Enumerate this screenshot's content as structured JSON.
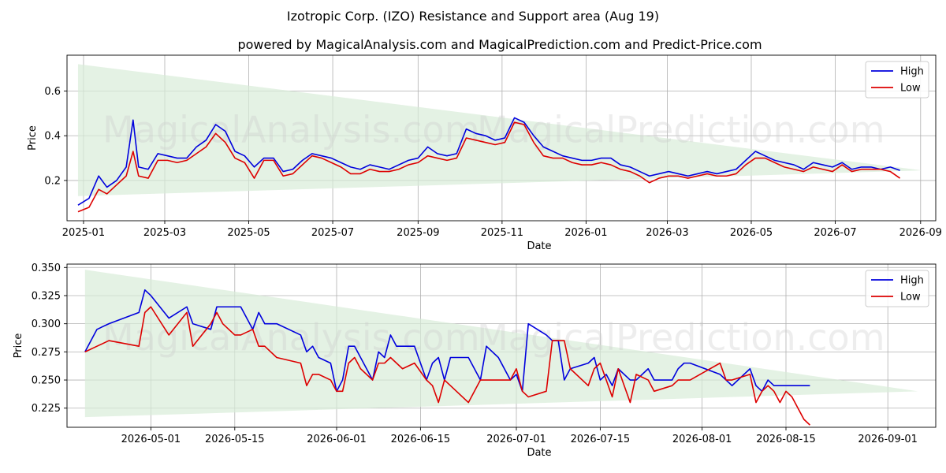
{
  "title": "Izotropic Corp. (IZO) Resistance and Support area (Aug 19)",
  "subtitle": "powered by MagicalAnalysis.com and MagicalPrediction.com and Predict-Price.com",
  "watermarks": [
    "MagicalAnalysis.com",
    "MagicalPrediction.com"
  ],
  "colors": {
    "high": "#0000dd",
    "low": "#dd0000",
    "band": "#d9ecd9"
  },
  "chart_data": [
    {
      "type": "line",
      "xlabel": "Date",
      "ylabel": "Price",
      "xlim": [
        "2024-12-20",
        "2026-09-12"
      ],
      "ylim": [
        0.02,
        0.76
      ],
      "xticks": [
        "2025-01",
        "2025-03",
        "2025-05",
        "2025-07",
        "2025-09",
        "2025-11",
        "2026-01",
        "2026-03",
        "2026-05",
        "2026-07",
        "2026-09"
      ],
      "yticks": [
        "0.2",
        "0.4",
        "0.6"
      ],
      "legend": "top-right",
      "grid": true,
      "band": {
        "start": "2024-12-28",
        "end": "2026-09-02",
        "upper_start": 0.72,
        "lower_start": 0.13,
        "upper_end": 0.245,
        "lower_end": 0.245
      },
      "series": [
        {
          "name": "High",
          "x": [
            "2024-12-28",
            "2025-01-05",
            "2025-01-12",
            "2025-01-18",
            "2025-01-25",
            "2025-02-01",
            "2025-02-06",
            "2025-02-10",
            "2025-02-17",
            "2025-02-24",
            "2025-03-03",
            "2025-03-10",
            "2025-03-17",
            "2025-03-24",
            "2025-03-31",
            "2025-04-07",
            "2025-04-14",
            "2025-04-21",
            "2025-04-28",
            "2025-05-05",
            "2025-05-12",
            "2025-05-19",
            "2025-05-26",
            "2025-06-02",
            "2025-06-09",
            "2025-06-16",
            "2025-06-23",
            "2025-06-30",
            "2025-07-07",
            "2025-07-14",
            "2025-07-21",
            "2025-07-28",
            "2025-08-04",
            "2025-08-11",
            "2025-08-18",
            "2025-08-25",
            "2025-09-01",
            "2025-09-08",
            "2025-09-15",
            "2025-09-22",
            "2025-09-29",
            "2025-10-06",
            "2025-10-13",
            "2025-10-20",
            "2025-10-27",
            "2025-11-03",
            "2025-11-10",
            "2025-11-17",
            "2025-11-24",
            "2025-12-01",
            "2025-12-08",
            "2025-12-15",
            "2025-12-22",
            "2025-12-29",
            "2026-01-05",
            "2026-01-12",
            "2026-01-19",
            "2026-01-26",
            "2026-02-02",
            "2026-02-09",
            "2026-02-16",
            "2026-02-23",
            "2026-03-02",
            "2026-03-09",
            "2026-03-16",
            "2026-03-23",
            "2026-03-30",
            "2026-04-06",
            "2026-04-13",
            "2026-04-20",
            "2026-04-27",
            "2026-05-04",
            "2026-05-11",
            "2026-05-18",
            "2026-05-25",
            "2026-06-01",
            "2026-06-08",
            "2026-06-15",
            "2026-06-22",
            "2026-06-29",
            "2026-07-06",
            "2026-07-13",
            "2026-07-20",
            "2026-07-27",
            "2026-08-03",
            "2026-08-10",
            "2026-08-17"
          ],
          "values": [
            0.09,
            0.12,
            0.22,
            0.17,
            0.2,
            0.26,
            0.47,
            0.26,
            0.25,
            0.32,
            0.31,
            0.3,
            0.3,
            0.35,
            0.38,
            0.45,
            0.42,
            0.33,
            0.31,
            0.26,
            0.3,
            0.3,
            0.24,
            0.25,
            0.29,
            0.32,
            0.31,
            0.3,
            0.28,
            0.26,
            0.25,
            0.27,
            0.26,
            0.25,
            0.27,
            0.29,
            0.3,
            0.35,
            0.32,
            0.31,
            0.32,
            0.43,
            0.41,
            0.4,
            0.38,
            0.39,
            0.48,
            0.46,
            0.4,
            0.35,
            0.33,
            0.31,
            0.3,
            0.29,
            0.29,
            0.3,
            0.3,
            0.27,
            0.26,
            0.24,
            0.22,
            0.23,
            0.24,
            0.23,
            0.22,
            0.23,
            0.24,
            0.23,
            0.24,
            0.25,
            0.29,
            0.33,
            0.31,
            0.29,
            0.28,
            0.27,
            0.25,
            0.28,
            0.27,
            0.26,
            0.28,
            0.25,
            0.26,
            0.26,
            0.25,
            0.26,
            0.245
          ]
        },
        {
          "name": "Low",
          "x": [
            "2024-12-28",
            "2025-01-05",
            "2025-01-12",
            "2025-01-18",
            "2025-01-25",
            "2025-02-01",
            "2025-02-06",
            "2025-02-10",
            "2025-02-17",
            "2025-02-24",
            "2025-03-03",
            "2025-03-10",
            "2025-03-17",
            "2025-03-24",
            "2025-03-31",
            "2025-04-07",
            "2025-04-14",
            "2025-04-21",
            "2025-04-28",
            "2025-05-05",
            "2025-05-12",
            "2025-05-19",
            "2025-05-26",
            "2025-06-02",
            "2025-06-09",
            "2025-06-16",
            "2025-06-23",
            "2025-06-30",
            "2025-07-07",
            "2025-07-14",
            "2025-07-21",
            "2025-07-28",
            "2025-08-04",
            "2025-08-11",
            "2025-08-18",
            "2025-08-25",
            "2025-09-01",
            "2025-09-08",
            "2025-09-15",
            "2025-09-22",
            "2025-09-29",
            "2025-10-06",
            "2025-10-13",
            "2025-10-20",
            "2025-10-27",
            "2025-11-03",
            "2025-11-10",
            "2025-11-17",
            "2025-11-24",
            "2025-12-01",
            "2025-12-08",
            "2025-12-15",
            "2025-12-22",
            "2025-12-29",
            "2026-01-05",
            "2026-01-12",
            "2026-01-19",
            "2026-01-26",
            "2026-02-02",
            "2026-02-09",
            "2026-02-16",
            "2026-02-23",
            "2026-03-02",
            "2026-03-09",
            "2026-03-16",
            "2026-03-23",
            "2026-03-30",
            "2026-04-06",
            "2026-04-13",
            "2026-04-20",
            "2026-04-27",
            "2026-05-04",
            "2026-05-11",
            "2026-05-18",
            "2026-05-25",
            "2026-06-01",
            "2026-06-08",
            "2026-06-15",
            "2026-06-22",
            "2026-06-29",
            "2026-07-06",
            "2026-07-13",
            "2026-07-20",
            "2026-07-27",
            "2026-08-03",
            "2026-08-10",
            "2026-08-17"
          ],
          "values": [
            0.06,
            0.08,
            0.16,
            0.14,
            0.18,
            0.22,
            0.33,
            0.22,
            0.21,
            0.29,
            0.29,
            0.28,
            0.29,
            0.32,
            0.35,
            0.41,
            0.37,
            0.3,
            0.28,
            0.21,
            0.29,
            0.29,
            0.22,
            0.23,
            0.27,
            0.31,
            0.3,
            0.28,
            0.26,
            0.23,
            0.23,
            0.25,
            0.24,
            0.24,
            0.25,
            0.27,
            0.28,
            0.31,
            0.3,
            0.29,
            0.3,
            0.39,
            0.38,
            0.37,
            0.36,
            0.37,
            0.46,
            0.45,
            0.37,
            0.31,
            0.3,
            0.3,
            0.28,
            0.27,
            0.27,
            0.28,
            0.27,
            0.25,
            0.24,
            0.22,
            0.19,
            0.21,
            0.22,
            0.22,
            0.21,
            0.22,
            0.23,
            0.22,
            0.22,
            0.23,
            0.27,
            0.3,
            0.3,
            0.28,
            0.26,
            0.25,
            0.24,
            0.26,
            0.25,
            0.24,
            0.27,
            0.24,
            0.25,
            0.25,
            0.25,
            0.24,
            0.21
          ]
        }
      ]
    },
    {
      "type": "line",
      "xlabel": "Date",
      "ylabel": "Price",
      "xlim": [
        "2026-04-17",
        "2026-09-09"
      ],
      "ylim": [
        0.208,
        0.353
      ],
      "xticks": [
        "2026-05-01",
        "2026-05-15",
        "2026-06-01",
        "2026-06-15",
        "2026-07-01",
        "2026-07-15",
        "2026-08-01",
        "2026-08-15",
        "2026-09-01"
      ],
      "yticks": [
        "0.225",
        "0.250",
        "0.275",
        "0.300",
        "0.325",
        "0.350"
      ],
      "legend": "top-right",
      "grid": true,
      "band": {
        "start": "2026-04-20",
        "end": "2026-09-06",
        "upper_start": 0.348,
        "lower_start": 0.217,
        "upper_end": 0.24,
        "lower_end": 0.24
      },
      "series": [
        {
          "name": "High",
          "x": [
            "2026-04-20",
            "2026-04-22",
            "2026-04-24",
            "2026-04-29",
            "2026-04-30",
            "2026-05-01",
            "2026-05-04",
            "2026-05-07",
            "2026-05-08",
            "2026-05-11",
            "2026-05-12",
            "2026-05-13",
            "2026-05-14",
            "2026-05-15",
            "2026-05-16",
            "2026-05-18",
            "2026-05-19",
            "2026-05-20",
            "2026-05-22",
            "2026-05-26",
            "2026-05-27",
            "2026-05-28",
            "2026-05-29",
            "2026-05-31",
            "2026-06-01",
            "2026-06-02",
            "2026-06-03",
            "2026-06-04",
            "2026-06-05",
            "2026-06-07",
            "2026-06-08",
            "2026-06-09",
            "2026-06-10",
            "2026-06-11",
            "2026-06-12",
            "2026-06-14",
            "2026-06-16",
            "2026-06-17",
            "2026-06-18",
            "2026-06-19",
            "2026-06-20",
            "2026-06-23",
            "2026-06-25",
            "2026-06-26",
            "2026-06-28",
            "2026-06-30",
            "2026-07-01",
            "2026-07-02",
            "2026-07-03",
            "2026-07-06",
            "2026-07-07",
            "2026-07-08",
            "2026-07-09",
            "2026-07-10",
            "2026-07-13",
            "2026-07-14",
            "2026-07-15",
            "2026-07-16",
            "2026-07-17",
            "2026-07-18",
            "2026-07-20",
            "2026-07-21",
            "2026-07-23",
            "2026-07-24",
            "2026-07-27",
            "2026-07-28",
            "2026-07-29",
            "2026-07-30",
            "2026-08-04",
            "2026-08-05",
            "2026-08-06",
            "2026-08-09",
            "2026-08-10",
            "2026-08-11",
            "2026-08-12",
            "2026-08-13",
            "2026-08-14",
            "2026-08-15",
            "2026-08-16",
            "2026-08-17",
            "2026-08-18",
            "2026-08-19"
          ],
          "values": [
            0.275,
            0.295,
            0.3,
            0.31,
            0.33,
            0.325,
            0.305,
            0.315,
            0.3,
            0.295,
            0.315,
            0.315,
            0.315,
            0.315,
            0.315,
            0.295,
            0.31,
            0.3,
            0.3,
            0.29,
            0.275,
            0.28,
            0.27,
            0.265,
            0.24,
            0.25,
            0.28,
            0.28,
            0.27,
            0.25,
            0.275,
            0.27,
            0.29,
            0.28,
            0.28,
            0.28,
            0.25,
            0.265,
            0.27,
            0.25,
            0.27,
            0.27,
            0.25,
            0.28,
            0.27,
            0.25,
            0.255,
            0.24,
            0.3,
            0.29,
            0.285,
            0.285,
            0.25,
            0.26,
            0.265,
            0.27,
            0.25,
            0.255,
            0.245,
            0.26,
            0.25,
            0.25,
            0.26,
            0.25,
            0.25,
            0.26,
            0.265,
            0.265,
            0.255,
            0.25,
            0.245,
            0.26,
            0.245,
            0.24,
            0.25,
            0.245,
            0.245,
            0.245,
            0.245,
            0.245,
            0.245,
            0.245
          ]
        },
        {
          "name": "Low",
          "x": [
            "2026-04-20",
            "2026-04-22",
            "2026-04-24",
            "2026-04-29",
            "2026-04-30",
            "2026-05-01",
            "2026-05-04",
            "2026-05-07",
            "2026-05-08",
            "2026-05-11",
            "2026-05-12",
            "2026-05-13",
            "2026-05-14",
            "2026-05-15",
            "2026-05-16",
            "2026-05-18",
            "2026-05-19",
            "2026-05-20",
            "2026-05-22",
            "2026-05-26",
            "2026-05-27",
            "2026-05-28",
            "2026-05-29",
            "2026-05-31",
            "2026-06-01",
            "2026-06-02",
            "2026-06-03",
            "2026-06-04",
            "2026-06-05",
            "2026-06-07",
            "2026-06-08",
            "2026-06-09",
            "2026-06-10",
            "2026-06-11",
            "2026-06-12",
            "2026-06-14",
            "2026-06-16",
            "2026-06-17",
            "2026-06-18",
            "2026-06-19",
            "2026-06-20",
            "2026-06-23",
            "2026-06-25",
            "2026-06-26",
            "2026-06-28",
            "2026-06-30",
            "2026-07-01",
            "2026-07-02",
            "2026-07-03",
            "2026-07-06",
            "2026-07-07",
            "2026-07-08",
            "2026-07-09",
            "2026-07-10",
            "2026-07-13",
            "2026-07-14",
            "2026-07-15",
            "2026-07-16",
            "2026-07-17",
            "2026-07-18",
            "2026-07-20",
            "2026-07-21",
            "2026-07-23",
            "2026-07-24",
            "2026-07-27",
            "2026-07-28",
            "2026-07-29",
            "2026-07-30",
            "2026-08-04",
            "2026-08-05",
            "2026-08-06",
            "2026-08-09",
            "2026-08-10",
            "2026-08-11",
            "2026-08-12",
            "2026-08-13",
            "2026-08-14",
            "2026-08-15",
            "2026-08-16",
            "2026-08-17",
            "2026-08-18",
            "2026-08-19"
          ],
          "values": [
            0.275,
            0.28,
            0.285,
            0.28,
            0.31,
            0.315,
            0.29,
            0.31,
            0.28,
            0.3,
            0.31,
            0.3,
            0.295,
            0.29,
            0.29,
            0.295,
            0.28,
            0.28,
            0.27,
            0.265,
            0.245,
            0.255,
            0.255,
            0.25,
            0.24,
            0.24,
            0.265,
            0.27,
            0.26,
            0.25,
            0.265,
            0.265,
            0.27,
            0.265,
            0.26,
            0.265,
            0.25,
            0.245,
            0.23,
            0.25,
            0.245,
            0.23,
            0.25,
            0.25,
            0.25,
            0.25,
            0.26,
            0.24,
            0.235,
            0.24,
            0.285,
            0.285,
            0.285,
            0.26,
            0.245,
            0.26,
            0.265,
            0.25,
            0.235,
            0.26,
            0.23,
            0.255,
            0.25,
            0.24,
            0.245,
            0.25,
            0.25,
            0.25,
            0.265,
            0.25,
            0.25,
            0.255,
            0.23,
            0.24,
            0.245,
            0.24,
            0.23,
            0.24,
            0.235,
            0.225,
            0.215,
            0.21
          ]
        }
      ]
    }
  ]
}
